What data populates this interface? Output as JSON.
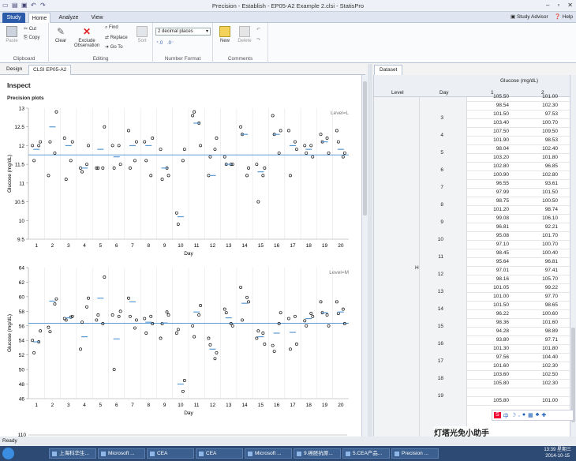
{
  "window": {
    "title": "Precision - Establish - EP05-A2 Example 2.clsi - StatisPro"
  },
  "menu": {
    "study": "Study",
    "home": "Home",
    "analyze": "Analyze",
    "view": "View",
    "advisor": "Study Advisor",
    "help": "Help"
  },
  "ribbon": {
    "paste": "Paste",
    "cut": "Cut",
    "copy": "Copy",
    "clipboard": "Clipboard",
    "clear": "Clear",
    "exclude": "Exclude",
    "observation": "Observation",
    "find": "Find",
    "replace": "Replace",
    "goto": "Go To",
    "sort": "Sort",
    "editing": "Editing",
    "decimals": "2 decimal places",
    "number_format": "Number Format",
    "new": "New",
    "delete": "Delete",
    "comments": "Comments"
  },
  "subtabs": {
    "design": "Design",
    "clsi": "CLSI EP05-A2"
  },
  "inspect": {
    "title": "Inspect",
    "precision_plots": "Precision plots"
  },
  "dataset": {
    "tab": "Dataset",
    "header": "Glucose (mg/dL)",
    "level": "Level",
    "day": "Day",
    "col1": "1",
    "col2": "2",
    "level_value": "H"
  },
  "rows": [
    {
      "day": "",
      "a": "105.50",
      "b": "101.00"
    },
    {
      "day": "",
      "a": "98.54",
      "b": "102.30"
    },
    {
      "day": "3",
      "a": "101.50",
      "b": "97.53"
    },
    {
      "day": "",
      "a": "103.40",
      "b": "100.70"
    },
    {
      "day": "4",
      "a": "107.50",
      "b": "109.50"
    },
    {
      "day": "",
      "a": "101.90",
      "b": "98.53"
    },
    {
      "day": "5",
      "a": "98.04",
      "b": "102.40"
    },
    {
      "day": "",
      "a": "103.20",
      "b": "101.80"
    },
    {
      "day": "6",
      "a": "102.80",
      "b": "96.85"
    },
    {
      "day": "",
      "a": "100.90",
      "b": "102.80"
    },
    {
      "day": "7",
      "a": "96.55",
      "b": "93.61"
    },
    {
      "day": "",
      "a": "97.99",
      "b": "101.50"
    },
    {
      "day": "8",
      "a": "98.75",
      "b": "100.50"
    },
    {
      "day": "",
      "a": "101.20",
      "b": "98.74"
    },
    {
      "day": "9",
      "a": "99.08",
      "b": "106.10"
    },
    {
      "day": "",
      "a": "96.81",
      "b": "92.21"
    },
    {
      "day": "10",
      "a": "95.08",
      "b": "101.70"
    },
    {
      "day": "",
      "a": "97.10",
      "b": "100.70"
    },
    {
      "day": "11",
      "a": "98.45",
      "b": "100.40"
    },
    {
      "day": "",
      "a": "95.64",
      "b": "96.81"
    },
    {
      "day": "12",
      "a": "97.01",
      "b": "97.41"
    },
    {
      "day": "",
      "a": "98.16",
      "b": "105.70"
    },
    {
      "day": "13",
      "a": "101.05",
      "b": "99.22"
    },
    {
      "day": "",
      "a": "101.00",
      "b": "97.70"
    },
    {
      "day": "14",
      "a": "101.50",
      "b": "98.65"
    },
    {
      "day": "",
      "a": "96.22",
      "b": "100.60"
    },
    {
      "day": "15",
      "a": "98.36",
      "b": "101.60"
    },
    {
      "day": "",
      "a": "94.28",
      "b": "98.89"
    },
    {
      "day": "16",
      "a": "93.80",
      "b": "97.71"
    },
    {
      "day": "",
      "a": "101.30",
      "b": "101.80"
    },
    {
      "day": "17",
      "a": "97.56",
      "b": "104.40"
    },
    {
      "day": "",
      "a": "101.60",
      "b": "102.30"
    },
    {
      "day": "18",
      "a": "103.60",
      "b": "102.50"
    },
    {
      "day": "",
      "a": "105.80",
      "b": "102.30"
    },
    {
      "day": "19",
      "a": "",
      "b": ""
    },
    {
      "day": "",
      "a": "105.80",
      "b": "101.00"
    }
  ],
  "status": "Ready",
  "taskbar": {
    "items": [
      "上海科华生...",
      "Microsoft ...",
      "CEA",
      "CEA",
      "Microsoft ...",
      "9.癌胚抗原...",
      "5.CEA产品...",
      "Precision ..."
    ],
    "time": "13:39 星期三",
    "date": "2014-10-15"
  },
  "watermark": "灯塔光免小助手",
  "chart_data": [
    {
      "type": "scatter",
      "title": "",
      "legend": "Level=L",
      "xlabel": "Day",
      "ylabel": "Glucose (mg/dL)",
      "ylim": [
        9.5,
        13
      ],
      "yticks": [
        "9.5",
        "10",
        "10.5",
        "11",
        "11.5",
        "12",
        "12.5",
        "13"
      ],
      "x": [
        1,
        2,
        3,
        4,
        5,
        6,
        7,
        8,
        9,
        10,
        11,
        12,
        13,
        14,
        15,
        16,
        17,
        18,
        19,
        20
      ],
      "series": [
        {
          "values": [
            [
              12.0,
              12.1,
              11.6,
              12.0
            ],
            [
              11.2,
              12.9,
              12.1,
              11.8
            ],
            [
              12.2,
              12.1,
              11.1,
              11.6
            ],
            [
              11.4,
              12.0,
              11.3,
              11.5
            ],
            [
              11.4,
              12.5,
              11.4,
              11.4
            ],
            [
              12.0,
              11.5,
              11.4,
              12.0
            ],
            [
              12.4,
              12.1,
              11.4,
              11.6
            ],
            [
              12.1,
              12.2,
              11.6,
              11.2
            ],
            [
              11.9,
              11.2,
              11.1,
              11.4
            ],
            [
              10.2,
              11.9,
              9.9,
              11.6
            ],
            [
              12.8,
              12.0,
              12.9,
              12.6
            ],
            [
              11.2,
              12.2,
              11.7,
              11.9
            ],
            [
              11.7,
              11.5,
              11.5,
              11.5
            ],
            [
              12.5,
              11.4,
              12.3,
              11.2
            ],
            [
              11.5,
              11.4,
              10.5,
              11.2
            ],
            [
              12.8,
              12.4,
              12.3,
              11.8
            ],
            [
              12.4,
              11.9,
              11.2,
              12.1
            ],
            [
              12.0,
              11.7,
              11.8,
              12.0
            ],
            [
              12.3,
              11.8,
              12.1,
              12.2
            ],
            [
              12.4,
              11.8,
              12.1,
              11.7
            ]
          ]
        },
        {
          "name": "mean",
          "values": [
            11.9,
            12.5,
            12.0,
            11.4,
            11.9,
            11.7,
            12.0,
            12.0,
            11.4,
            10.1,
            12.6,
            11.2,
            11.5,
            12.3,
            11.3,
            12.3,
            12.0,
            11.9,
            12.1,
            11.9
          ]
        }
      ],
      "grand_mean": 11.75
    },
    {
      "type": "scatter",
      "title": "",
      "legend": "Level=M",
      "xlabel": "Day",
      "ylabel": "Glucose (mg/dL)",
      "ylim": [
        46,
        64
      ],
      "yticks": [
        "46",
        "48",
        "50",
        "52",
        "54",
        "56",
        "58",
        "60",
        "62",
        "64"
      ],
      "x": [
        1,
        2,
        3,
        4,
        5,
        6,
        7,
        8,
        9,
        10,
        11,
        12,
        13,
        14,
        15,
        16,
        17,
        18,
        19,
        20
      ],
      "series": [
        {
          "values": [
            [
              54.0,
              55.3,
              52.3,
              53.8
            ],
            [
              55.8,
              59.7,
              55.2,
              59.0
            ],
            [
              57.0,
              57.3,
              56.8,
              57.2
            ],
            [
              52.8,
              59.8,
              56.5,
              58.6
            ],
            [
              56.8,
              62.7,
              57.5,
              56.3
            ],
            [
              57.5,
              58.0,
              50.0,
              57.3
            ],
            [
              59.8,
              56.8,
              57.3,
              55.7
            ],
            [
              57.0,
              56.3,
              55.0,
              57.3
            ],
            [
              54.3,
              57.5,
              56.3,
              57.9
            ],
            [
              55.0,
              48.5,
              55.5,
              47.0
            ],
            [
              56.0,
              58.8,
              54.5,
              57.5
            ],
            [
              54.3,
              52.3,
              53.4,
              51.5
            ],
            [
              58.3,
              56.0,
              57.8,
              56.3
            ],
            [
              61.3,
              59.3,
              56.8,
              59.9
            ],
            [
              54.3,
              53.5,
              55.3,
              55.0
            ],
            [
              53.3,
              57.8,
              52.5,
              56.3
            ],
            [
              57.0,
              53.5,
              52.8,
              57.3
            ],
            [
              56.7,
              57.3,
              56.0,
              57.7
            ],
            [
              59.3,
              56.0,
              57.8,
              57.5
            ],
            [
              59.3,
              56.3,
              57.7,
              58.3
            ]
          ]
        },
        {
          "name": "mean",
          "values": [
            53.8,
            59.4,
            57.1,
            54.5,
            59.8,
            54.2,
            59.3,
            56.5,
            56.4,
            48.0,
            57.9,
            52.8,
            57.1,
            59.1,
            54.5,
            55.0,
            55.1,
            57.0,
            57.8,
            57.9
          ]
        }
      ],
      "grand_mean": 56.35
    }
  ]
}
